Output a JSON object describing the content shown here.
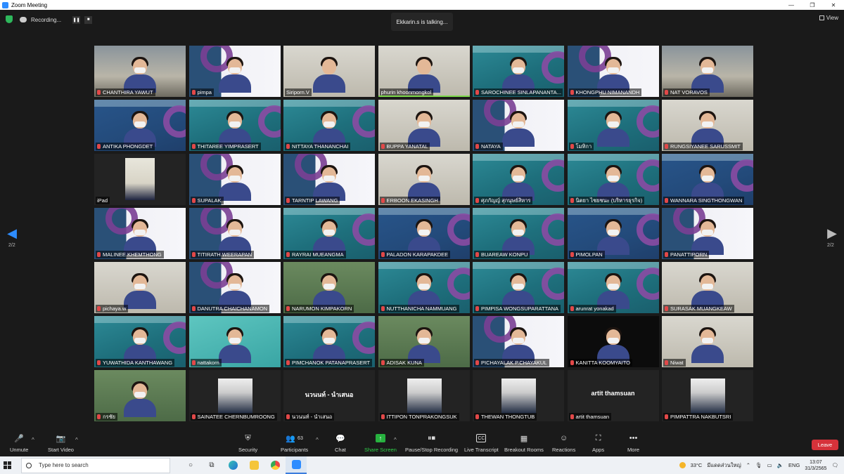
{
  "window": {
    "title": "Zoom Meeting",
    "minimize": "—",
    "maximize": "❐",
    "close": "✕"
  },
  "top": {
    "recording_label": "Recording...",
    "pause": "❚❚",
    "stop": "■",
    "talking": "Ekkarin.s is talking...",
    "view_label": "View"
  },
  "pager": {
    "left": "2/2",
    "right": "2/2",
    "prev_arrow": "◀",
    "next_arrow": "▶"
  },
  "participants": [
    {
      "name": "CHANTHIRA YAWUT",
      "bg": "photo",
      "muted": true
    },
    {
      "name": "pimpa",
      "bg": "lilac",
      "muted": true
    },
    {
      "name": "Siriporn.V",
      "bg": "room",
      "muted": false
    },
    {
      "name": "phurin khoonmongkol",
      "bg": "room",
      "muted": false,
      "talking": true
    },
    {
      "name": "SAROCHINEE SINLAPANANTA...",
      "bg": "teal",
      "muted": true
    },
    {
      "name": "KHONGPHU NIMANANDH",
      "bg": "lilac",
      "muted": true
    },
    {
      "name": "NAT VORAVOS",
      "bg": "photo",
      "muted": true
    },
    {
      "name": "ANTIKA PHONGDET",
      "bg": "navy",
      "muted": true
    },
    {
      "name": "THITAREE YIMPRASERT",
      "bg": "teal",
      "muted": true
    },
    {
      "name": "NITTAYA THANANCHAI",
      "bg": "teal",
      "muted": true
    },
    {
      "name": "BUPPA YANATAL",
      "bg": "room",
      "muted": true
    },
    {
      "name": "NATAYA",
      "bg": "lilac",
      "muted": true
    },
    {
      "name": "โมทิกา",
      "bg": "teal",
      "muted": true
    },
    {
      "name": "RUNGSIYANEE SARUSSMIT",
      "bg": "room",
      "muted": true
    },
    {
      "name": "iPad",
      "bg": "dark",
      "muted": false,
      "ipad": true
    },
    {
      "name": "SUPALAK",
      "bg": "lilac",
      "muted": true
    },
    {
      "name": "TARNTIP LAWANG",
      "bg": "lilac",
      "muted": true
    },
    {
      "name": "ERBOON EKASINGH",
      "bg": "room",
      "muted": true
    },
    {
      "name": "ศุภกัญญ์ สุกนุษย์สิหาร",
      "bg": "teal",
      "muted": true
    },
    {
      "name": "นิตยา ไชยชนะ (บริหารธุรกิจ)",
      "bg": "teal",
      "muted": true
    },
    {
      "name": "WANNARA SINGTHONGWAN",
      "bg": "navy",
      "muted": true
    },
    {
      "name": "MALINEE KHEMTHONG",
      "bg": "lilac",
      "muted": true
    },
    {
      "name": "TITIRATH WEERAPAN",
      "bg": "lilac",
      "muted": true
    },
    {
      "name": "RAYRAI MUEANGMA",
      "bg": "teal",
      "muted": true
    },
    {
      "name": "PALADON KARAPAKDEE",
      "bg": "navy",
      "muted": true
    },
    {
      "name": "BUAREAW KONPU",
      "bg": "teal",
      "muted": true
    },
    {
      "name": "PIMOLPAN",
      "bg": "navy",
      "muted": true
    },
    {
      "name": "PANATTIPORN",
      "bg": "lilac",
      "muted": true
    },
    {
      "name": "pichaya.w",
      "bg": "room",
      "muted": true
    },
    {
      "name": "DANUTRA CHAICHANAMON",
      "bg": "lilac",
      "muted": true
    },
    {
      "name": "NARUMON KIMPAKORN",
      "bg": "green",
      "muted": true
    },
    {
      "name": "NUTTHANICHA NAMMUANG",
      "bg": "teal",
      "muted": true
    },
    {
      "name": "PIMPISA WONGSUPARATTANA",
      "bg": "teal",
      "muted": true
    },
    {
      "name": "arunrat yonakad",
      "bg": "teal",
      "muted": true
    },
    {
      "name": "SURASAK MUANGKEAW",
      "bg": "room",
      "muted": true
    },
    {
      "name": "YUWATHIDA KANTHAWANG",
      "bg": "teal",
      "muted": true
    },
    {
      "name": "nattakorn",
      "bg": "mint",
      "muted": true
    },
    {
      "name": "PIMCHANOK PATANAPRASERT",
      "bg": "teal",
      "muted": true
    },
    {
      "name": "ADISAK KUNA",
      "bg": "green",
      "muted": true
    },
    {
      "name": "PICHAYALAK P.CHAYAKUL",
      "bg": "lilac",
      "muted": true
    },
    {
      "name": "KANITTA KOOMYAITO",
      "bg": "black",
      "muted": true
    },
    {
      "name": "Niwat",
      "bg": "room",
      "muted": true
    },
    {
      "name": "กรชัย",
      "bg": "green",
      "muted": true
    },
    {
      "name": "SAINATEE CHERNBUMROONG",
      "bg": "dark",
      "muted": true,
      "pic": true
    },
    {
      "name": "นวนนท์ - นำเสนอ",
      "bg": "dark",
      "muted": true,
      "caption": "นวนนท์ - นำเสนอ"
    },
    {
      "name": "ITTIPON TONPRAKONGSUK",
      "bg": "dark",
      "muted": true,
      "pic": true
    },
    {
      "name": "THEWAN THONGTUB",
      "bg": "dark",
      "muted": true,
      "pic": true
    },
    {
      "name": "artit thamsuan",
      "bg": "dark",
      "muted": true,
      "caption": "artit thamsuan"
    },
    {
      "name": "PIMPATTRA NAKBUTSRI",
      "bg": "dark",
      "muted": true,
      "pic": true
    }
  ],
  "toolbar": {
    "unmute": "Unmute",
    "start_video": "Start Video",
    "security": "Security",
    "participants": "Participants",
    "participants_count": "63",
    "chat": "Chat",
    "share_screen": "Share Screen",
    "recording": "Pause/Stop Recording",
    "transcript": "Live Transcript",
    "breakout": "Breakout Rooms",
    "reactions": "Reactions",
    "apps": "Apps",
    "more": "More",
    "leave": "Leave",
    "cc": "CC",
    "more_dots": "•••",
    "caret": "^"
  },
  "taskbar": {
    "search_placeholder": "Type here to search",
    "temperature": "33°C",
    "weather": "มีแดดส่วนใหญ่",
    "lang": "ENG",
    "time": "13:07",
    "date": "31/3/2565"
  }
}
